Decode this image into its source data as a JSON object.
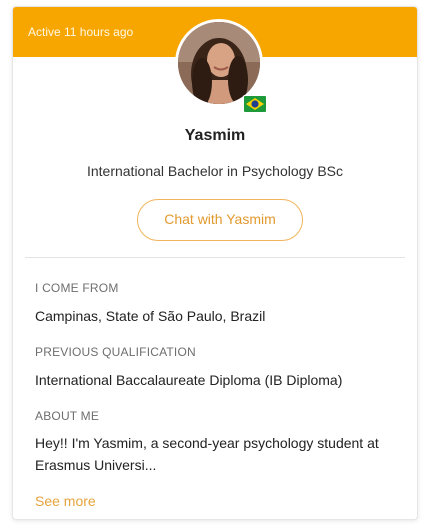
{
  "card": {
    "activity": "Active 11 hours ago",
    "name": "Yasmim",
    "program": "International Bachelor in Psychology BSc",
    "chat_button": "Chat with Yasmim",
    "flag_icon": "brazil-flag-icon"
  },
  "details": {
    "from_label": "I COME FROM",
    "from_value": "Campinas, State of São Paulo, Brazil",
    "qualification_label": "PREVIOUS QUALIFICATION",
    "qualification_value": "International Baccalaureate Diploma (IB Diploma)",
    "about_label": "ABOUT ME",
    "about_value": "Hey!! I'm Yasmim, a second-year psychology student at Erasmus Universi...",
    "see_more": "See more"
  },
  "colors": {
    "header": "#f7a600",
    "accent": "#e29a2f"
  }
}
